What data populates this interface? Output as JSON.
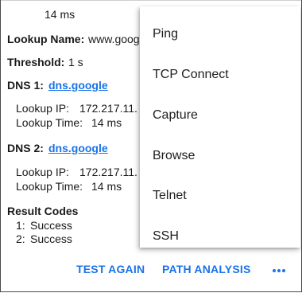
{
  "detail": {
    "time_top": "14 ms",
    "lookup_name_label": "Lookup Name:",
    "lookup_name_value": "www.google.com",
    "threshold_label": "Threshold:",
    "threshold_value": "1 s",
    "dns1_label": "DNS 1:",
    "dns1_link": "dns.google",
    "dns1_ip_label": "Lookup IP:",
    "dns1_ip_value": "172.217.11.",
    "dns1_time_label": "Lookup Time:",
    "dns1_time_value": "14 ms",
    "dns2_label": "DNS 2:",
    "dns2_link": "dns.google",
    "dns2_ip_label": "Lookup IP:",
    "dns2_ip_value": "172.217.11.",
    "dns2_time_label": "Lookup Time:",
    "dns2_time_value": "14 ms",
    "result_codes_label": "Result Codes",
    "result_codes": [
      {
        "num": "1:",
        "status": "Success"
      },
      {
        "num": "2:",
        "status": "Success"
      }
    ]
  },
  "actions": {
    "test_again": "TEST AGAIN",
    "path_analysis": "PATH ANALYSIS",
    "more_icon": "more-horiz-icon"
  },
  "menu": {
    "items": [
      {
        "label": "Ping"
      },
      {
        "label": "TCP Connect"
      },
      {
        "label": "Capture"
      },
      {
        "label": "Browse"
      },
      {
        "label": "Telnet"
      },
      {
        "label": "SSH"
      }
    ]
  },
  "colors": {
    "accent": "#1a73e8",
    "text": "#1a1a1a"
  }
}
